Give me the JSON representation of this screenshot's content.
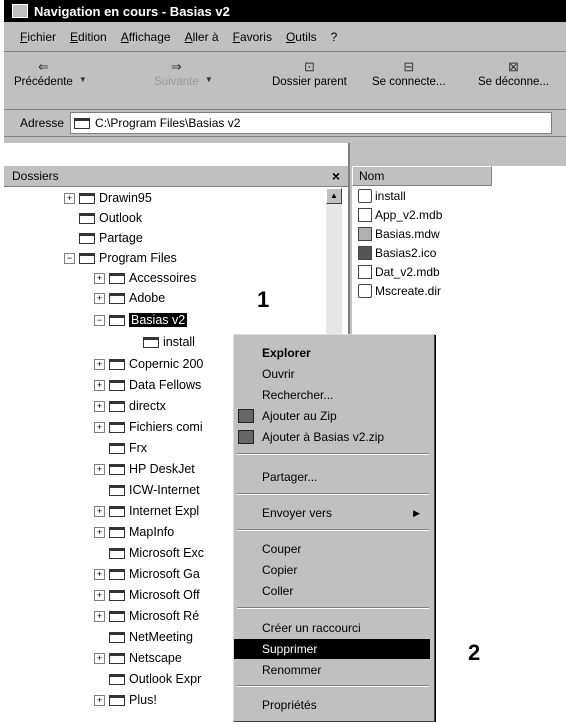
{
  "window": {
    "title": "Navigation en cours - Basias v2"
  },
  "menu": [
    "Fichier",
    "Edition",
    "Affichage",
    "Aller à",
    "Favoris",
    "Outils",
    "?"
  ],
  "toolbar": {
    "back": "Précédente",
    "forward": "Suivante",
    "parent": "Dossier parent",
    "connect": "Se connecte...",
    "disconnect": "Se déconne..."
  },
  "address": {
    "label": "Adresse",
    "value": "C:\\Program Files\\Basias v2"
  },
  "folders_pane": {
    "title": "Dossiers",
    "close": "×",
    "items": [
      "Drawin95",
      "Outlook",
      "Partage",
      "Program Files",
      "Accessoires",
      "Adobe",
      "Basias v2",
      "install",
      "Copernic 200",
      "Data Fellows",
      "directx",
      "Fichiers comi",
      "Frx",
      "HP DeskJet",
      "ICW-Internet",
      "Internet Expl",
      "MapInfo",
      "Microsoft Exc",
      "Microsoft Ga",
      "Microsoft Off",
      "Microsoft Ré",
      "NetMeeting",
      "Netscape",
      "Outlook Expr",
      "Plus!"
    ]
  },
  "files_pane": {
    "column_name": "Nom",
    "files": [
      "install",
      "App_v2.mdb",
      "Basias.mdw",
      "Basias2.ico",
      "Dat_v2.mdb",
      "Mscreate.dir"
    ]
  },
  "context_menu": {
    "explore": "Explorer",
    "open": "Ouvrir",
    "search": "Rechercher...",
    "add_zip": "Ajouter au Zip",
    "add_named_zip": "Ajouter à Basias v2.zip",
    "share": "Partager...",
    "send_to": "Envoyer vers",
    "cut": "Couper",
    "copy": "Copier",
    "paste": "Coller",
    "shortcut": "Créer un raccourci",
    "delete": "Supprimer",
    "rename": "Renommer",
    "properties": "Propriétés"
  },
  "annotations": {
    "one": "1",
    "two": "2"
  }
}
